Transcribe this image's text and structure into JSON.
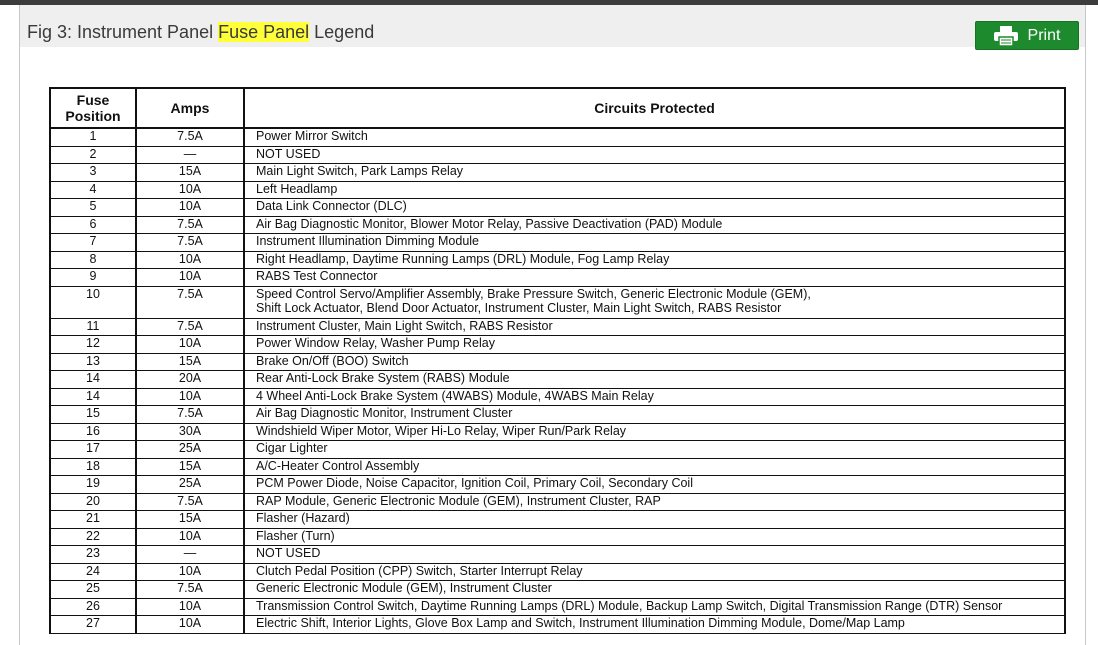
{
  "header": {
    "title_prefix": "Fig 3: Instrument Panel ",
    "title_highlight": "Fuse Panel",
    "title_suffix": " Legend",
    "print_label": "Print",
    "print_icon": "printer-icon",
    "highlight_color": "#ffff3a",
    "button_color": "#1e8a2e"
  },
  "table": {
    "headers": {
      "position_line1": "Fuse",
      "position_line2": "Position",
      "amps": "Amps",
      "circuits": "Circuits Protected"
    },
    "rows": [
      {
        "pos": "1",
        "amps": "7.5A",
        "circuits": "Power Mirror Switch"
      },
      {
        "pos": "2",
        "amps": "—",
        "circuits": "NOT USED"
      },
      {
        "pos": "3",
        "amps": "15A",
        "circuits": "Main Light Switch, Park Lamps Relay"
      },
      {
        "pos": "4",
        "amps": "10A",
        "circuits": "Left Headlamp"
      },
      {
        "pos": "5",
        "amps": "10A",
        "circuits": "Data Link Connector (DLC)"
      },
      {
        "pos": "6",
        "amps": "7.5A",
        "circuits": "Air Bag Diagnostic Monitor, Blower Motor Relay, Passive Deactivation (PAD) Module"
      },
      {
        "pos": "7",
        "amps": "7.5A",
        "circuits": "Instrument Illumination Dimming Module"
      },
      {
        "pos": "8",
        "amps": "10A",
        "circuits": "Right Headlamp, Daytime Running Lamps (DRL) Module, Fog Lamp Relay"
      },
      {
        "pos": "9",
        "amps": "10A",
        "circuits": "RABS Test Connector"
      },
      {
        "pos": "10",
        "amps": "7.5A",
        "circuits": "Speed Control Servo/Amplifier Assembly, Brake Pressure Switch, Generic Electronic Module (GEM),",
        "circuits2": "Shift Lock Actuator, Blend Door Actuator, Instrument Cluster, Main Light Switch, RABS Resistor"
      },
      {
        "pos": "11",
        "amps": "7.5A",
        "circuits": "Instrument Cluster, Main Light Switch, RABS Resistor"
      },
      {
        "pos": "12",
        "amps": "10A",
        "circuits": "Power Window Relay, Washer Pump Relay"
      },
      {
        "pos": "13",
        "amps": "15A",
        "circuits": "Brake On/Off (BOO) Switch"
      },
      {
        "pos": "14",
        "amps": "20A",
        "circuits": "Rear Anti-Lock Brake System (RABS) Module"
      },
      {
        "pos": "14",
        "amps": "10A",
        "circuits": "4 Wheel Anti-Lock Brake System (4WABS) Module, 4WABS Main Relay"
      },
      {
        "pos": "15",
        "amps": "7.5A",
        "circuits": "Air Bag Diagnostic Monitor, Instrument Cluster"
      },
      {
        "pos": "16",
        "amps": "30A",
        "circuits": "Windshield Wiper Motor, Wiper Hi-Lo Relay, Wiper Run/Park Relay"
      },
      {
        "pos": "17",
        "amps": "25A",
        "circuits": "Cigar Lighter"
      },
      {
        "pos": "18",
        "amps": "15A",
        "circuits": "A/C-Heater Control Assembly"
      },
      {
        "pos": "19",
        "amps": "25A",
        "circuits": "PCM Power Diode, Noise Capacitor, Ignition Coil, Primary Coil, Secondary Coil"
      },
      {
        "pos": "20",
        "amps": "7.5A",
        "circuits": "RAP Module, Generic Electronic Module (GEM), Instrument Cluster, RAP"
      },
      {
        "pos": "21",
        "amps": "15A",
        "circuits": "Flasher (Hazard)"
      },
      {
        "pos": "22",
        "amps": "10A",
        "circuits": "Flasher (Turn)"
      },
      {
        "pos": "23",
        "amps": "—",
        "circuits": "NOT USED"
      },
      {
        "pos": "24",
        "amps": "10A",
        "circuits": "Clutch Pedal Position (CPP) Switch, Starter Interrupt Relay"
      },
      {
        "pos": "25",
        "amps": "7.5A",
        "circuits": "Generic Electronic Module (GEM), Instrument Cluster"
      },
      {
        "pos": "26",
        "amps": "10A",
        "circuits": "Transmission Control Switch, Daytime Running Lamps (DRL) Module, Backup Lamp Switch, Digital Transmission Range (DTR) Sensor"
      },
      {
        "pos": "27",
        "amps": "10A",
        "circuits": "Electric Shift, Interior Lights, Glove Box Lamp and Switch, Instrument Illumination Dimming Module, Dome/Map Lamp"
      }
    ]
  }
}
